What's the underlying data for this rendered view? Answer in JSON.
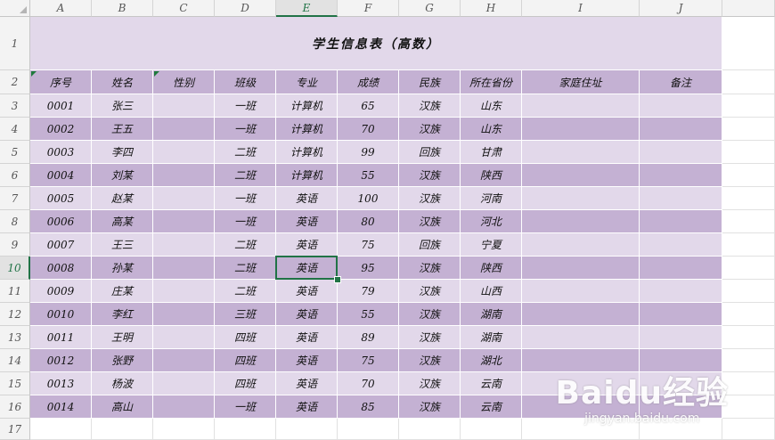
{
  "sheet": {
    "columns": [
      "A",
      "B",
      "C",
      "D",
      "E",
      "F",
      "G",
      "H",
      "I",
      "J"
    ],
    "selected_column": "E",
    "selected_row": 10,
    "row_numbers": [
      1,
      2,
      3,
      4,
      5,
      6,
      7,
      8,
      9,
      10,
      11,
      12,
      13,
      14,
      15,
      16,
      17
    ],
    "title": "学生信息表（高数）",
    "headers": [
      "序号",
      "姓名",
      "性别",
      "班级",
      "专业",
      "成绩",
      "民族",
      "所在省份",
      "家庭住址",
      "备注"
    ],
    "rows": [
      [
        "0001",
        "张三",
        "",
        "一班",
        "计算机",
        "65",
        "汉族",
        "山东",
        "",
        ""
      ],
      [
        "0002",
        "王五",
        "",
        "一班",
        "计算机",
        "70",
        "汉族",
        "山东",
        "",
        ""
      ],
      [
        "0003",
        "李四",
        "",
        "二班",
        "计算机",
        "99",
        "回族",
        "甘肃",
        "",
        ""
      ],
      [
        "0004",
        "刘某",
        "",
        "二班",
        "计算机",
        "55",
        "汉族",
        "陕西",
        "",
        ""
      ],
      [
        "0005",
        "赵某",
        "",
        "一班",
        "英语",
        "100",
        "汉族",
        "河南",
        "",
        ""
      ],
      [
        "0006",
        "高某",
        "",
        "一班",
        "英语",
        "80",
        "汉族",
        "河北",
        "",
        ""
      ],
      [
        "0007",
        "王三",
        "",
        "二班",
        "英语",
        "75",
        "回族",
        "宁夏",
        "",
        ""
      ],
      [
        "0008",
        "孙某",
        "",
        "二班",
        "英语",
        "95",
        "汉族",
        "陕西",
        "",
        ""
      ],
      [
        "0009",
        "庄某",
        "",
        "二班",
        "英语",
        "79",
        "汉族",
        "山西",
        "",
        ""
      ],
      [
        "0010",
        "李红",
        "",
        "三班",
        "英语",
        "55",
        "汉族",
        "湖南",
        "",
        ""
      ],
      [
        "0011",
        "王明",
        "",
        "四班",
        "英语",
        "89",
        "汉族",
        "湖南",
        "",
        ""
      ],
      [
        "0012",
        "张野",
        "",
        "四班",
        "英语",
        "75",
        "汉族",
        "湖北",
        "",
        ""
      ],
      [
        "0013",
        "杨波",
        "",
        "四班",
        "英语",
        "70",
        "汉族",
        "云南",
        "",
        ""
      ],
      [
        "0014",
        "高山",
        "",
        "一班",
        "英语",
        "85",
        "汉族",
        "云南",
        "",
        ""
      ]
    ]
  },
  "colors": {
    "title_fill": "#e2d8ea",
    "header_fill": "#c4b1d3",
    "band_light": "#e2d8ea",
    "band_dark": "#c4b1d3",
    "selection": "#217346"
  },
  "watermark": {
    "logo": "Baidu经验",
    "url": "jingyan.baidu.com"
  }
}
